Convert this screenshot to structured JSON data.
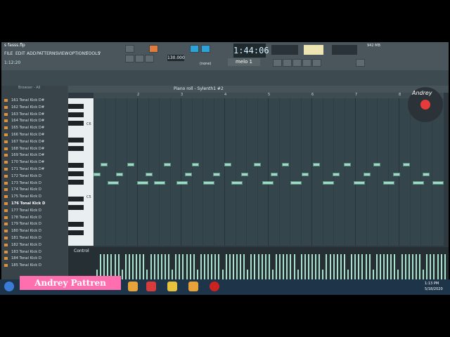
{
  "app": {
    "file_name": "s fasss.flp",
    "position": "1:12:20",
    "tempo": "130.000",
    "time_display": "1:44:06",
    "pattern_name": "melo 1",
    "mixer_label": "(none)",
    "ram": "942 MB"
  },
  "menu": [
    "FILE",
    "EDIT",
    "ADD",
    "PATTERNS",
    "VIEW",
    "OPTIONS",
    "TOOLS",
    "?"
  ],
  "browser": {
    "title": "Browser - All",
    "items": [
      "161 Tonal Kick D#",
      "162 Tonal Kick D#",
      "163 Tonal Kick D#",
      "164 Tonal Kick D#",
      "165 Tonal Kick D#",
      "166 Tonal Kick D#",
      "167 Tonal Kick D#",
      "168 Tonal Kick D#",
      "169 Tonal Kick D#",
      "170 Tonal Kick D#",
      "171 Tonal Kick D#",
      "172 Tonal Kick D",
      "173 Tonal Kick D",
      "174 Tonal Kick D",
      "175 Tonal Kick D",
      "176 Tonal Kick D",
      "177 Tonal Kick D",
      "178 Tonal Kick D",
      "179 Tonal Kick D",
      "180 Tonal Kick D",
      "181 Tonal Kick D",
      "182 Tonal Kick D",
      "183 Tonal Kick D",
      "184 Tonal Kick D",
      "185 Tonal Kick D"
    ],
    "selected_index": 15
  },
  "piano_roll": {
    "title": "Piano roll - Sylenth1 #2",
    "key_labels": [
      "C6",
      "C5"
    ],
    "bar_numbers": [
      "2",
      "3",
      "4",
      "5",
      "6",
      "7",
      "8"
    ],
    "control_label": "Control"
  },
  "overlay": {
    "watermark": "Andrey Pattren",
    "logo_text": "Andrey"
  },
  "taskbar": {
    "time": "1:13 PM",
    "date": "5/18/2020"
  },
  "colors": {
    "note": "#9fd9c6",
    "accent": "#2aa3d8",
    "watermark": "#ff6fb0"
  }
}
